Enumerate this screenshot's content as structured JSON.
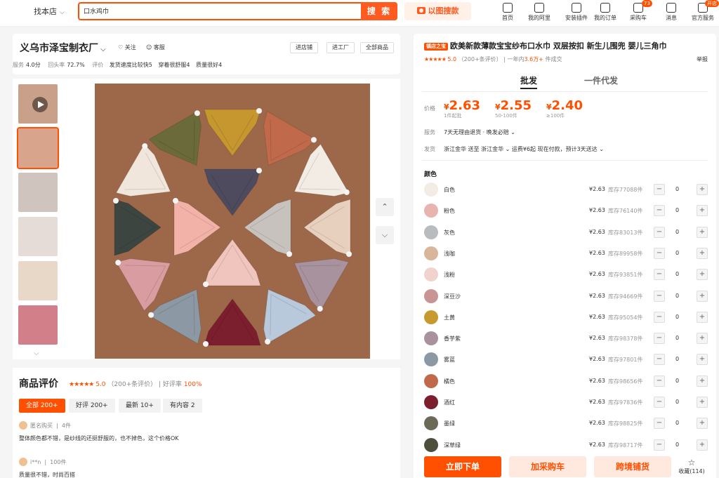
{
  "topbar": {
    "scope_label": "找本店",
    "search_value": "口水鸡巾",
    "search_button": "搜 索",
    "image_search": "以图搜款",
    "nav": [
      {
        "label": "首页",
        "icon": "home-icon"
      },
      {
        "label": "我的阿里",
        "icon": "shield-icon"
      },
      {
        "label": "安装插件",
        "icon": "puzzle-icon"
      },
      {
        "label": "我的订单",
        "icon": "order-icon"
      },
      {
        "label": "采购车",
        "icon": "cart-icon",
        "badge": "73"
      },
      {
        "label": "消息",
        "icon": "bell-icon"
      },
      {
        "label": "官方服务",
        "icon": "user-icon",
        "badge": "开店"
      }
    ]
  },
  "shop": {
    "name": "义乌市泽宝制衣厂",
    "follow": "关注",
    "service": "客服",
    "buttons": [
      "进店铺",
      "进工厂",
      "全部商品"
    ],
    "metrics": {
      "service_label": "服务",
      "service_value": "4.0分",
      "return_label": "回头率",
      "return_value": "72.7%",
      "review_label": "评价",
      "tags": [
        "发货速度比较快5",
        "穿着很舒服4",
        "质量很好4"
      ]
    }
  },
  "gallery": {
    "thumbs": [
      "#c9a08a",
      "#d8a48c",
      "#cfc4be",
      "#e5dcd7",
      "#e8d8c8",
      "#d27f8a"
    ]
  },
  "reviews": {
    "title": "商品评价",
    "stars": "★★★★★",
    "score": "5.0",
    "count": "（200+条评价）",
    "good_rate_label": "| 好评率",
    "good_rate": "100%",
    "tabs": [
      "全部 200+",
      "好评 200+",
      "最新 10+",
      "有内容 2"
    ],
    "items": [
      {
        "user": "匿名购买",
        "qty": "4件",
        "text": "整体颜色都不错，是纱线的还挺舒服的，也不掉色，这个价格OK"
      },
      {
        "user": "i**n",
        "qty": "100件",
        "text": "质量很不错，时尚百搭"
      }
    ]
  },
  "product": {
    "badge": "镇店之宝",
    "title": "欧美新款薄款宝宝纱布口水巾 双层按扣 新生儿围兜 婴儿三角巾",
    "stars": "★★★★★",
    "rating": "5.0",
    "rating_count": "（200+条评价）",
    "sales_prefix": "| 一年内",
    "sales_value": "3.6万+",
    "sales_suffix": "件成交",
    "report": "举报",
    "tabs": [
      "批发",
      "一件代发"
    ],
    "price_label": "价格",
    "prices": [
      {
        "sym": "¥",
        "value": "2.63",
        "note": "1件起批"
      },
      {
        "sym": "¥",
        "value": "2.55",
        "note": "50-100件"
      },
      {
        "sym": "¥",
        "value": "2.40",
        "note": "≥100件"
      }
    ],
    "service_label": "服务",
    "service_value": "7天无理由退货 · 晚发必赔 ⌄",
    "ship_label": "发货",
    "ship_value": "浙江金华 送至 浙江金华 ⌄   运费¥6起  现在付款，预计3天送达 ⌄",
    "color_label": "颜色",
    "colors": [
      {
        "name": "白色",
        "price": "¥2.63",
        "stock": "库存77088件",
        "qty": "0",
        "swatch": "#f2ece4"
      },
      {
        "name": "粉色",
        "price": "¥2.63",
        "stock": "库存76140件",
        "qty": "0",
        "swatch": "#e8b4ae"
      },
      {
        "name": "灰色",
        "price": "¥2.63",
        "stock": "库存83013件",
        "qty": "0",
        "swatch": "#b9bcbf"
      },
      {
        "name": "浅咖",
        "price": "¥2.63",
        "stock": "库存89958件",
        "qty": "0",
        "swatch": "#d9b59a"
      },
      {
        "name": "浅粉",
        "price": "¥2.63",
        "stock": "库存93851件",
        "qty": "0",
        "swatch": "#f1d3ce"
      },
      {
        "name": "深豆沙",
        "price": "¥2.63",
        "stock": "库存94669件",
        "qty": "0",
        "swatch": "#c99494"
      },
      {
        "name": "土黄",
        "price": "¥2.63",
        "stock": "库存95054件",
        "qty": "0",
        "swatch": "#c69a2f"
      },
      {
        "name": "香芋紫",
        "price": "¥2.63",
        "stock": "库存98378件",
        "qty": "0",
        "swatch": "#a8929e"
      },
      {
        "name": "雾蓝",
        "price": "¥2.63",
        "stock": "库存97801件",
        "qty": "0",
        "swatch": "#8c98a3"
      },
      {
        "name": "橘色",
        "price": "¥2.63",
        "stock": "库存98656件",
        "qty": "0",
        "swatch": "#c06a4b"
      },
      {
        "name": "酒红",
        "price": "¥2.63",
        "stock": "库存97836件",
        "qty": "0",
        "swatch": "#7b1e2e"
      },
      {
        "name": "墨绿",
        "price": "¥2.63",
        "stock": "库存98825件",
        "qty": "0",
        "swatch": "#6b6a56"
      },
      {
        "name": "深草绿",
        "price": "¥2.63",
        "stock": "库存98717件",
        "qty": "0",
        "swatch": "#4d4e3c"
      }
    ],
    "actions": {
      "order": "立即下单",
      "cart": "加采购车",
      "distribute": "跨境铺货",
      "collect": "收藏(114)"
    }
  },
  "image_colors": {
    "bibs": [
      "#c6962f",
      "#c06a4b",
      "#f2ece4",
      "#e8d0be",
      "#a8929e",
      "#b9c9dc",
      "#7b1e2e",
      "#8c98a3",
      "#d99ca0",
      "#3c4540",
      "#f0e6dc",
      "#6b6a3a",
      "#4e4b5e",
      "#c7c2bd",
      "#f0c5bd",
      "#f2b2a8"
    ]
  }
}
